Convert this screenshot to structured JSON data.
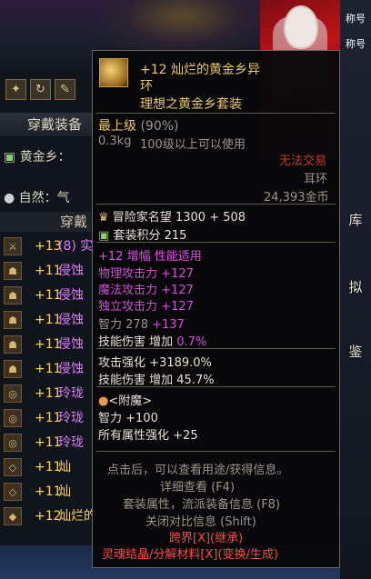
{
  "scene": {
    "top_right_labels": [
      "称号",
      "称号"
    ],
    "right_column": [
      "库",
      "拟",
      "鉴"
    ]
  },
  "left_panel": {
    "tool_icons": [
      "gear-icon",
      "recycle-icon",
      "brush-icon"
    ],
    "header": "穿戴装备",
    "set_line_1": "黄金乡：",
    "set_line_2": "自然：气",
    "sub_header": "穿戴",
    "slots": [
      {
        "level": "+13",
        "name": "(8) 实"
      },
      {
        "level": "+11",
        "name": "侵蚀"
      },
      {
        "level": "+11",
        "name": "侵蚀"
      },
      {
        "level": "+11",
        "name": "侵蚀"
      },
      {
        "level": "+11",
        "name": "侵蚀"
      },
      {
        "level": "+11",
        "name": "侵蚀"
      },
      {
        "level": "+11",
        "name": "玲珑"
      },
      {
        "level": "+11",
        "name": "玲珑"
      },
      {
        "level": "+11",
        "name": "玲珑"
      },
      {
        "level": "+11",
        "name": "灿"
      },
      {
        "level": "+11",
        "name": "灿"
      },
      {
        "level": "+12",
        "name": "灿烂的"
      }
    ]
  },
  "tooltip": {
    "title_line1": "+12 灿烂的黄金乡异",
    "title_line2": "环",
    "set_name": "理想之黄金乡套装",
    "grade": "最上级",
    "grade_pct": "(90%)",
    "weight": "0.3kg",
    "level_req": "100级以上可以使用",
    "trade_status": "无法交易",
    "slot_type": "耳环",
    "price": "24,393金币",
    "adventurer_label": "冒险家名望",
    "adventurer_value": "1300 + 508",
    "set_points_label": "套装积分",
    "set_points_value": "215",
    "amplify_header": "+12 增幅 性能适用",
    "stats": [
      {
        "name": "物理攻击力",
        "value": "+127"
      },
      {
        "name": "魔法攻击力",
        "value": "+127"
      },
      {
        "name": "独立攻击力",
        "value": "+127"
      }
    ],
    "int_label": "智力",
    "int_base": "278",
    "int_bonus": "+137",
    "skill_dmg_label": "技能伤害 增加",
    "skill_dmg_value": "0.7%",
    "atk_boost_label": "攻击强化",
    "atk_boost_value": "+3189.0%",
    "skill_dmg2_label": "技能伤害 增加",
    "skill_dmg2_value": "45.7%",
    "enchant_header": "<附魔>",
    "enchant_int": "智力 +100",
    "enchant_all_label": "所有属性强化",
    "enchant_all_value": "+25",
    "hint1": "点击后，可以查看用途/获得信息。",
    "hint2": "详细查看 (F4)",
    "hint3": "套装属性，流派装备信息 (F8)",
    "hint4": "关闭对比信息 (Shift)",
    "cross_server": "跨界[X](继承)",
    "soul": "灵魂结晶/分解材料[X](变换/生成)"
  },
  "colors": {
    "gold": "#e9c76a",
    "pink": "#e14fe8",
    "red": "#ff4a3a"
  }
}
